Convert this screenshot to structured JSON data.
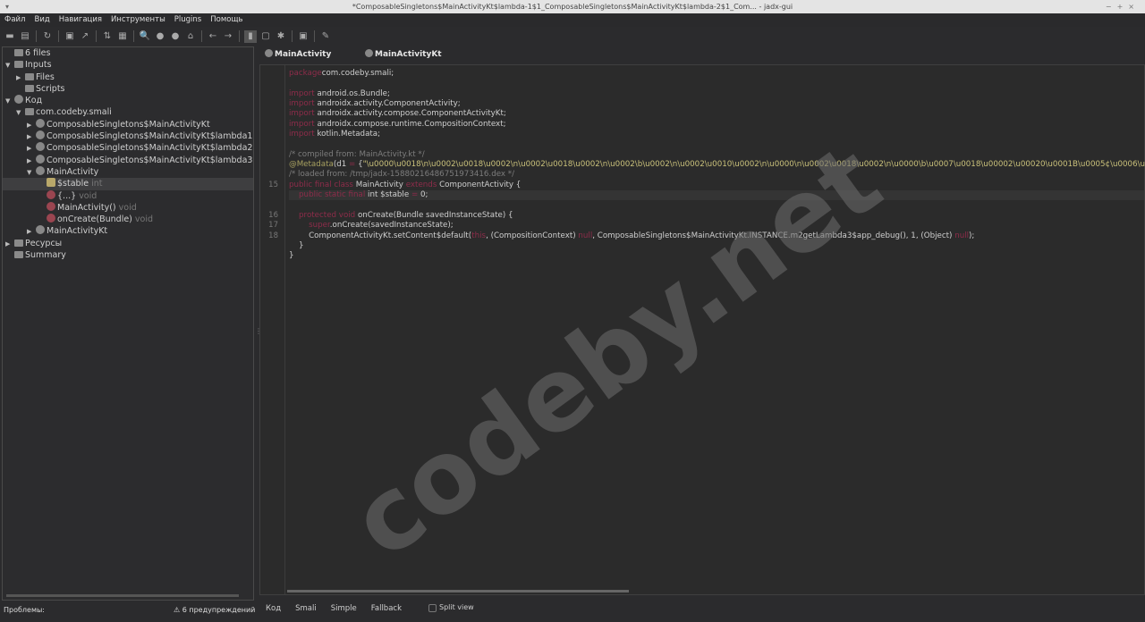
{
  "window": {
    "title": "*ComposableSingletons$MainActivityKt$lambda-1$1_ComposableSingletons$MainActivityKt$lambda-2$1_Com... - jadx-gui"
  },
  "menu": [
    "Файл",
    "Вид",
    "Навигация",
    "Инструменты",
    "Plugins",
    "Помощь"
  ],
  "toolbar": [
    "open-icon",
    "add-files-icon",
    "sync-icon",
    "save-icon",
    "export-icon",
    "sync-tree-icon",
    "flatten-packages-icon",
    "search-icon",
    "find-class-icon",
    "find-usage-icon",
    "home-icon",
    "back-icon",
    "forward-icon",
    "quark-icon",
    "log-icon",
    "debug-icon",
    "preferences-icon",
    "settings-icon"
  ],
  "tree": [
    {
      "label": "6 files",
      "level": 0,
      "tw": "",
      "icon": "files-icon"
    },
    {
      "label": "Inputs",
      "level": 0,
      "tw": "▼",
      "icon": "folder-icon"
    },
    {
      "label": "Files",
      "level": 1,
      "tw": "▶",
      "icon": "folder-icon"
    },
    {
      "label": "Scripts",
      "level": 1,
      "tw": "",
      "icon": "folder-icon"
    },
    {
      "label": "Код",
      "level": 0,
      "tw": "▼",
      "icon": "code-icon"
    },
    {
      "label": "com.codeby.smali",
      "level": 1,
      "tw": "▼",
      "icon": "package-icon"
    },
    {
      "label": "ComposableSingletons$MainActivityKt",
      "level": 2,
      "tw": "▶",
      "icon": "class-icon"
    },
    {
      "label": "ComposableSingletons$MainActivityKt$lambda1",
      "level": 2,
      "tw": "▶",
      "icon": "class-icon"
    },
    {
      "label": "ComposableSingletons$MainActivityKt$lambda2",
      "level": 2,
      "tw": "▶",
      "icon": "class-icon"
    },
    {
      "label": "ComposableSingletons$MainActivityKt$lambda3",
      "level": 2,
      "tw": "▶",
      "icon": "class-icon"
    },
    {
      "label": "MainActivity",
      "level": 2,
      "tw": "▼",
      "icon": "class-icon"
    },
    {
      "label": "$stable",
      "type": "int",
      "level": 3,
      "tw": "",
      "icon": "field-icon",
      "selected": true
    },
    {
      "label": "{...}",
      "type": "void",
      "level": 3,
      "tw": "",
      "icon": "method-icon"
    },
    {
      "label": "MainActivity()",
      "type": "void",
      "level": 3,
      "tw": "",
      "icon": "method-icon"
    },
    {
      "label": "onCreate(Bundle)",
      "type": "void",
      "level": 3,
      "tw": "",
      "icon": "method-icon"
    },
    {
      "label": "MainActivityKt",
      "level": 2,
      "tw": "▶",
      "icon": "class-icon"
    },
    {
      "label": "Ресурсы",
      "level": 0,
      "tw": "▶",
      "icon": "folder-icon"
    },
    {
      "label": "Summary",
      "level": 0,
      "tw": "",
      "icon": "summary-icon"
    }
  ],
  "tabs": [
    {
      "label": "MainActivity",
      "active": true
    },
    {
      "label": "MainActivityKt"
    }
  ],
  "code": [
    {
      "n": "",
      "t": [
        [
          "kw",
          "package"
        ],
        [
          "",
          "com.codeby.smali;"
        ]
      ]
    },
    {
      "n": "",
      "t": []
    },
    {
      "n": "",
      "t": [
        [
          "kw",
          "import"
        ],
        [
          "",
          " android.os.Bundle;"
        ]
      ]
    },
    {
      "n": "",
      "t": [
        [
          "kw",
          "import"
        ],
        [
          "",
          " androidx.activity.ComponentActivity;"
        ]
      ]
    },
    {
      "n": "",
      "t": [
        [
          "kw",
          "import"
        ],
        [
          "",
          " androidx.activity.compose.ComponentActivityKt;"
        ]
      ]
    },
    {
      "n": "",
      "t": [
        [
          "kw",
          "import"
        ],
        [
          "",
          " androidx.compose.runtime.CompositionContext;"
        ]
      ]
    },
    {
      "n": "",
      "t": [
        [
          "kw",
          "import"
        ],
        [
          "",
          " kotlin.Metadata;"
        ]
      ]
    },
    {
      "n": "",
      "t": []
    },
    {
      "n": "",
      "t": [
        [
          "cm",
          "/* compiled from: MainActivity.kt */"
        ]
      ]
    },
    {
      "n": "",
      "t": [
        [
          "an",
          "@Metadata"
        ],
        [
          "",
          "(d1 "
        ],
        [
          "op",
          "="
        ],
        [
          "",
          " {"
        ],
        [
          "st",
          "\"\\u0000\\u0018\\n\\u0002\\u0018\\u0002\\n\\u0002\\u0018\\u0002\\n\\u0002\\b\\u0002\\n\\u0002\\u0010\\u0002\\n\\u0000\\n\\u0002\\u0018\\u0002\\n\\u0000\\b\\u0007\\u0018\\u00002\\u00020\\u0001B\\u0005¢\\u0006\\u0002\\u"
        ]
      ]
    },
    {
      "n": "",
      "t": [
        [
          "cm",
          "/* loaded from: /tmp/jadx-15880216486751973416.dex */"
        ]
      ]
    },
    {
      "n": "15",
      "t": [
        [
          "kw",
          "public final class"
        ],
        [
          "",
          " MainActivity "
        ],
        [
          "kw",
          "extends"
        ],
        [
          "",
          " ComponentActivity {"
        ]
      ]
    },
    {
      "n": "",
      "cur": true,
      "t": [
        [
          "",
          "    "
        ],
        [
          "kw",
          "public static final"
        ],
        [
          "",
          " int $stable "
        ],
        [
          "op",
          "="
        ],
        [
          "",
          " 0;"
        ]
      ]
    },
    {
      "n": "",
      "t": []
    },
    {
      "n": "16",
      "t": [
        [
          "",
          "    "
        ],
        [
          "kw",
          "protected void"
        ],
        [
          "",
          " onCreate(Bundle savedInstanceState) {"
        ]
      ]
    },
    {
      "n": "17",
      "t": [
        [
          "",
          "        "
        ],
        [
          "kw",
          "super"
        ],
        [
          "",
          ".onCreate(savedInstanceState);"
        ]
      ]
    },
    {
      "n": "18",
      "t": [
        [
          "",
          "        ComponentActivityKt.setContent$default("
        ],
        [
          "kw",
          "this"
        ],
        [
          "",
          ", (CompositionContext) "
        ],
        [
          "kw",
          "null"
        ],
        [
          "",
          ", ComposableSingletons$MainActivityKt.INSTANCE.m2getLambda3$app_debug(), 1, (Object) "
        ],
        [
          "kw",
          "null"
        ],
        [
          "",
          ");"
        ]
      ]
    },
    {
      "n": "",
      "t": [
        [
          "",
          "    }"
        ]
      ]
    },
    {
      "n": "",
      "t": [
        [
          "",
          "}"
        ]
      ]
    }
  ],
  "watermark": "codeby.net",
  "status": {
    "problems_label": "Проблемы:",
    "warnings": "6 предупреждений"
  },
  "modes": [
    "Код",
    "Smali",
    "Simple",
    "Fallback"
  ],
  "split_view": {
    "label": "Split view",
    "checked": false
  },
  "colors": {
    "keyword": "#8e2c4a",
    "comment": "#7d7d7d",
    "string": "#c9c07a",
    "background": "#2b2b2b"
  }
}
